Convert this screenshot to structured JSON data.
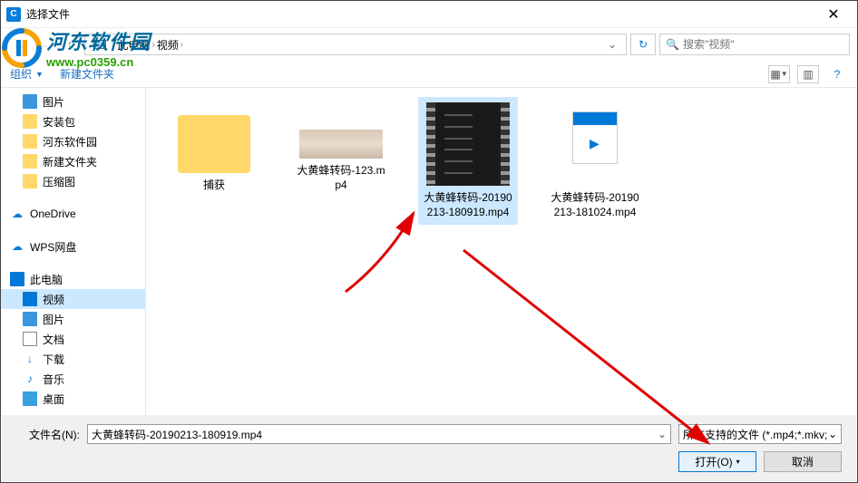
{
  "window": {
    "title": "选择文件"
  },
  "breadcrumb": {
    "loc1": "此电脑",
    "loc2": "视频"
  },
  "search": {
    "placeholder": "搜索\"视频\""
  },
  "toolbar": {
    "organize": "组织",
    "newfolder": "新建文件夹"
  },
  "sidebar": {
    "items": [
      {
        "label": "图片",
        "cls": "pic"
      },
      {
        "label": "安装包",
        "cls": "folder"
      },
      {
        "label": "河东软件园",
        "cls": "folder"
      },
      {
        "label": "新建文件夹",
        "cls": "folder"
      },
      {
        "label": "压缩图",
        "cls": "folder"
      }
    ],
    "onedrive": "OneDrive",
    "wps": "WPS网盘",
    "thispc": "此电脑",
    "video": "视频",
    "pic2": "图片",
    "docs": "文档",
    "downloads": "下载",
    "music": "音乐",
    "desktop": "桌面"
  },
  "files": [
    {
      "name": "捕获"
    },
    {
      "name": "大黄蜂转码-123.mp4"
    },
    {
      "name": "大黄蜂转码-20190213-180919.mp4"
    },
    {
      "name": "大黄蜂转码-20190213-181024.mp4"
    }
  ],
  "footer": {
    "fname_label": "文件名(N):",
    "fname_value": "大黄蜂转码-20190213-180919.mp4",
    "filter": "所有支持的文件 (*.mp4;*.mkv;",
    "open": "打开(O)",
    "cancel": "取消"
  },
  "watermark": {
    "cn": "河东软件园",
    "url": "www.pc0359.cn"
  }
}
